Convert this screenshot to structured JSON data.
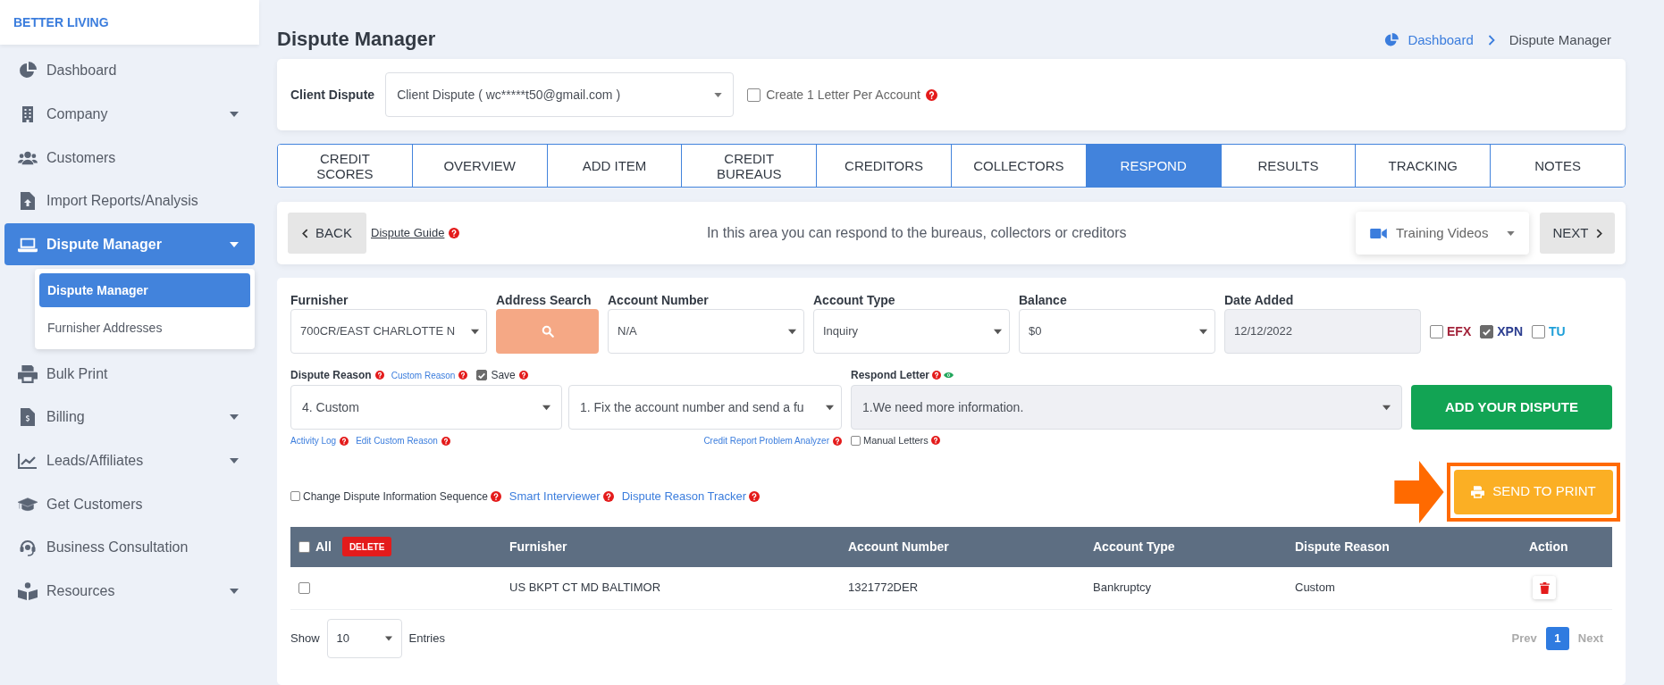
{
  "sidebar": {
    "brand": "BETTER LIVING",
    "items": [
      {
        "label": "Dashboard",
        "kind": "link",
        "selected": false
      },
      {
        "label": "Company",
        "kind": "menu",
        "selected": false
      },
      {
        "label": "Customers",
        "kind": "link",
        "selected": false
      },
      {
        "label": "Import Reports/Analysis",
        "kind": "link",
        "selected": false
      },
      {
        "label": "Dispute Manager",
        "kind": "menu",
        "selected": true,
        "children": [
          {
            "label": "Dispute Manager",
            "selected": true
          },
          {
            "label": "Furnisher Addresses",
            "selected": false
          }
        ]
      },
      {
        "label": "Bulk Print",
        "kind": "link",
        "selected": false
      },
      {
        "label": "Billing",
        "kind": "menu",
        "selected": false
      },
      {
        "label": "Leads/Affiliates",
        "kind": "menu",
        "selected": false
      },
      {
        "label": "Get Customers",
        "kind": "link",
        "selected": false
      },
      {
        "label": "Business Consultation",
        "kind": "link",
        "selected": false
      },
      {
        "label": "Resources",
        "kind": "menu",
        "selected": false
      }
    ]
  },
  "page": {
    "title": "Dispute Manager",
    "breadcrumb": [
      "Dashboard",
      "Dispute Manager"
    ]
  },
  "client_dispute": {
    "label": "Client Dispute",
    "value": "Client Dispute ( wc*****t50@gmail.com )",
    "create_letter": {
      "label": "Create 1 Letter Per Account",
      "checked": false
    }
  },
  "tabs": [
    {
      "label": "CREDIT SCORES",
      "selected": false
    },
    {
      "label": "OVERVIEW",
      "selected": false
    },
    {
      "label": "ADD ITEM",
      "selected": false
    },
    {
      "label": "CREDIT BUREAUS",
      "selected": false
    },
    {
      "label": "CREDITORS",
      "selected": false
    },
    {
      "label": "COLLECTORS",
      "selected": false
    },
    {
      "label": "RESPOND",
      "selected": true
    },
    {
      "label": "RESULTS",
      "selected": false
    },
    {
      "label": "TRACKING",
      "selected": false
    },
    {
      "label": "NOTES",
      "selected": false
    }
  ],
  "guide_bar": {
    "back": "BACK",
    "guide_link": "Dispute Guide",
    "message": "In this area you can respond to the bureaus, collectors or creditors",
    "training": "Training Videos",
    "next": "NEXT"
  },
  "form": {
    "fields": [
      {
        "label": "Furnisher",
        "kind": "select",
        "value": "700CR/EAST CHARLOTTE N",
        "disabled": false
      },
      {
        "label": "Address Search",
        "kind": "search_button"
      },
      {
        "label": "Account Number",
        "kind": "select",
        "value": "N/A",
        "disabled": false
      },
      {
        "label": "Account Type",
        "kind": "select",
        "value": "Inquiry",
        "disabled": false
      },
      {
        "label": "Balance",
        "kind": "select",
        "value": "$0",
        "disabled": false
      },
      {
        "label": "Date Added",
        "kind": "input",
        "value": "12/12/2022",
        "disabled": true
      }
    ],
    "bureaus": [
      {
        "label": "EFX",
        "checked": false,
        "color": "#a3243b"
      },
      {
        "label": "XPN",
        "checked": true,
        "color": "#2b3d8f"
      },
      {
        "label": "TU",
        "checked": false,
        "color": "#1e9fd8"
      }
    ],
    "dispute_reason": {
      "label": "Dispute Reason",
      "custom_reason_link": "Custom Reason",
      "save": {
        "label": "Save",
        "checked": true
      },
      "value": "4. Custom",
      "instruction": "1. Fix the account number and send a fu",
      "links": [
        "Activity Log",
        "Edit Custom Reason"
      ],
      "analyzer_link": "Credit Report Problem Analyzer"
    },
    "respond_letter": {
      "label": "Respond Letter",
      "value": "1.We need more information.",
      "disabled": true,
      "manual_letters": {
        "label": "Manual Letters",
        "checked": false
      }
    },
    "add_button": "ADD YOUR DISPUTE",
    "sequence": {
      "label": "Change Dispute Information Sequence",
      "checked": false
    },
    "links": [
      "Smart Interviewer",
      "Dispute Reason Tracker"
    ],
    "send_button": "SEND TO PRINT"
  },
  "table": {
    "select_all": {
      "label": "All",
      "checked": false
    },
    "delete_button": "DELETE",
    "columns": [
      "Furnisher",
      "Account Number",
      "Account Type",
      "Dispute Reason",
      "Action"
    ],
    "rows": [
      {
        "checked": false,
        "cells": [
          "US BKPT CT MD BALTIMOR",
          "1321772DER",
          "Bankruptcy",
          "Custom"
        ]
      }
    ],
    "show_label": "Show",
    "page_size": "10",
    "entries_label": "Entries",
    "pagination": {
      "prev": "Prev",
      "pages": [
        {
          "label": "1",
          "selected": true
        }
      ],
      "next": "Next"
    }
  }
}
